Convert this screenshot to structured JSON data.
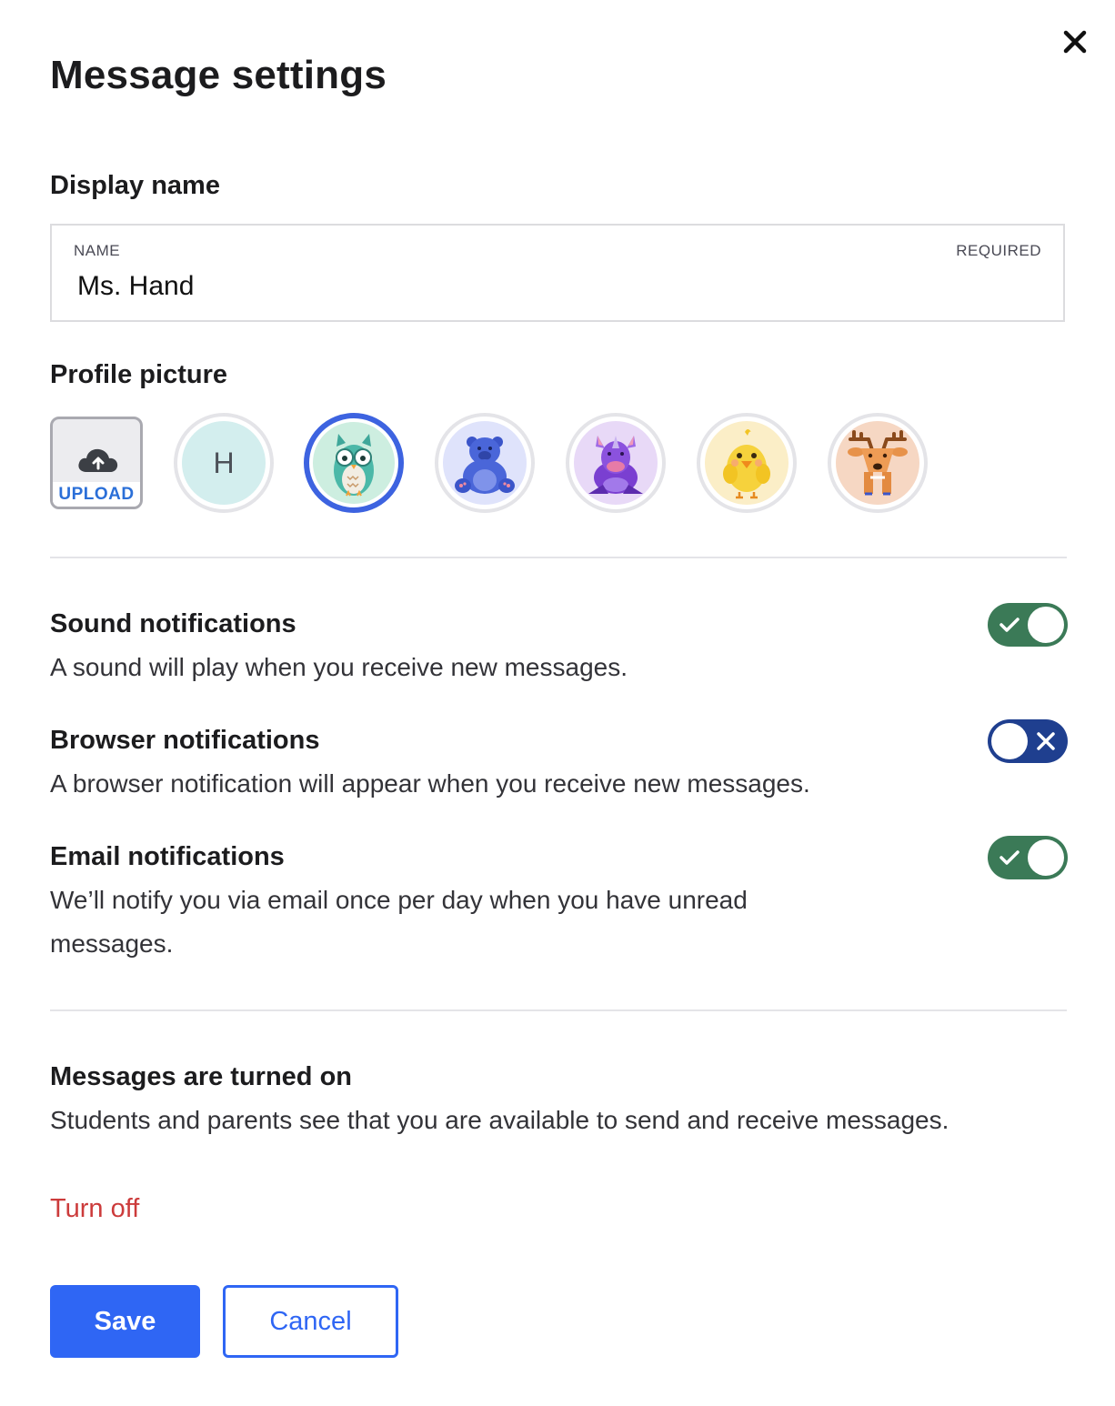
{
  "dialog": {
    "title": "Message settings",
    "close_icon": "close-icon"
  },
  "display_name": {
    "heading": "Display name",
    "field_label": "NAME",
    "required_label": "REQUIRED",
    "value": "Ms. Hand"
  },
  "profile_picture": {
    "heading": "Profile picture",
    "upload_label": "UPLOAD",
    "upload_icon": "cloud-upload-icon",
    "initial": "H",
    "options": [
      {
        "name": "initial-avatar",
        "bg": "#d3eeee"
      },
      {
        "name": "owl-avatar",
        "bg": "#cdeee0",
        "selected": true
      },
      {
        "name": "bear-avatar",
        "bg": "#dfe3fb"
      },
      {
        "name": "rhino-avatar",
        "bg": "#e8d9f7"
      },
      {
        "name": "chick-avatar",
        "bg": "#fbeec7"
      },
      {
        "name": "deer-avatar",
        "bg": "#f6d7c3"
      }
    ],
    "selected_color": "#3d63e0"
  },
  "notifications": {
    "sound": {
      "title": "Sound notifications",
      "description": "A sound will play when you receive new messages.",
      "enabled": true
    },
    "browser": {
      "title": "Browser notifications",
      "description": "A browser notification will appear when you receive new messages.",
      "enabled": false
    },
    "email": {
      "title": "Email notifications",
      "description": "We’ll notify you via email once per day when you have unread messages.",
      "enabled": true
    }
  },
  "messages_status": {
    "title": "Messages are turned on",
    "description": "Students and parents see that you are available to send and receive messages.",
    "turn_off_label": "Turn off"
  },
  "actions": {
    "save_label": "Save",
    "cancel_label": "Cancel"
  },
  "colors": {
    "toggle_on": "#3b7a57",
    "toggle_off": "#1f3f8f",
    "primary": "#2f66f4",
    "danger": "#cc3b3b"
  }
}
